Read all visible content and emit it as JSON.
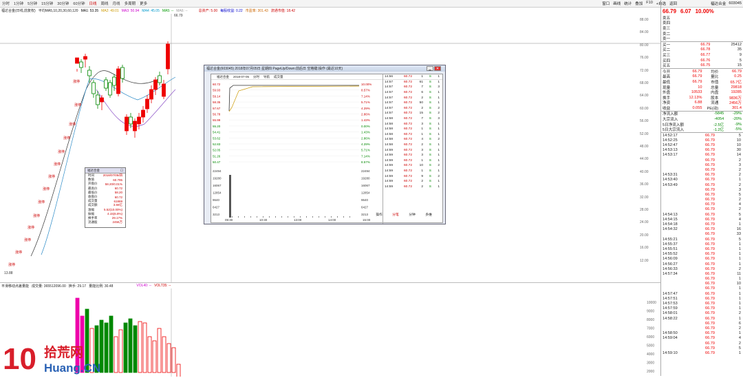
{
  "topbar": {
    "timeframes": [
      "分时",
      "1分钟",
      "5分钟",
      "15分钟",
      "30分钟",
      "60分钟",
      "日线",
      "周线",
      "月线",
      "多周期",
      "更多"
    ],
    "active": 6,
    "right": [
      "窗口",
      "画线",
      "统计",
      "叠加",
      "F10",
      "+自选",
      "返回"
    ]
  },
  "maline": {
    "stock": "福达合金(日线,前复权)",
    "ma": "平均MA5,10,20,30,60,120",
    "ma1": "MA1: 53.35",
    "ma2": "MA2: 49.01",
    "ma3": "MA3: 50.94",
    "ma4": "MA4: 45.05",
    "ma5": "MA5: --",
    "ma6": "MA6: --",
    "extra1": "总资产: 5.00",
    "extra2": "每股收益: 0.22",
    "extra3": "市盈率: 301.43",
    "extra4": "流通市值: 18.42"
  },
  "price_axis": [
    "88.00",
    "84.00",
    "80.00",
    "76.00",
    "72.00",
    "68.00",
    "64.00",
    "60.00",
    "56.00",
    "52.00",
    "48.00",
    "44.00",
    "40.00",
    "36.00",
    "32.00",
    "28.00",
    "24.00",
    "20.00",
    "16.00",
    "12.00"
  ],
  "cur_tag": "66.71",
  "high_label": "66.79",
  "low_label": "13.88",
  "stop_label": "涨停",
  "infobox": {
    "title": "福达合金",
    "rows": [
      [
        "时间",
        "2018/07/05/四"
      ],
      [
        "数值",
        "60.795"
      ],
      [
        "开盘价",
        "58.20/0.01%"
      ],
      [
        "最高价",
        "60.72"
      ],
      [
        "最低价",
        "58.20"
      ],
      [
        "收盘价",
        "60.72"
      ],
      [
        "成交量",
        "61869"
      ],
      [
        "成交额",
        "3.66亿"
      ],
      [
        "涨幅",
        "5.52(10.00%)"
      ],
      [
        "振幅",
        "4.15(6.8%)"
      ],
      [
        "换手率",
        "29.17%"
      ],
      [
        "流通股",
        "2456万"
      ]
    ]
  },
  "popup": {
    "title": "福达合金(603045) 2018年07月05日 星期四 PageUp/Down:前后日 空格键:操作 (最近10天)",
    "hd": [
      "福达合金",
      "2018-07-05",
      "分时",
      "导航",
      "成交量"
    ],
    "left_axis": [
      "60.72",
      "59.93",
      "59.14",
      "58.35",
      "57.67",
      "56.78",
      "55.99",
      "55.20",
      "54.41",
      "53.62",
      "52.83",
      "52.05",
      "51.26",
      "50.47"
    ],
    "right_axis": [
      "10.00%",
      "8.57%",
      "7.14%",
      "5.71%",
      "4.29%",
      "2.86%",
      "1.43%",
      "0.00%",
      "1.43%",
      "2.86%",
      "4.29%",
      "5.71%",
      "7.14%",
      "8.57%"
    ],
    "vol_axis": [
      "22494",
      "19280",
      "16067",
      "12854",
      "9640",
      "6427",
      "3213"
    ],
    "times": [
      "09:30",
      "10:30",
      "13:00",
      "14:00",
      "15:00"
    ],
    "tabs": [
      "操作",
      "分笔",
      "分钟",
      "多维"
    ],
    "ticks": [
      [
        "14:56",
        "60.72",
        "1",
        "S",
        "1"
      ],
      [
        "14:57",
        "60.72",
        "61",
        "S",
        "1"
      ],
      [
        "14:57",
        "60.72",
        "7",
        "S",
        "3"
      ],
      [
        "14:57",
        "60.72",
        "6",
        "S",
        "1"
      ],
      [
        "14:57",
        "60.72",
        "2",
        "S",
        "1"
      ],
      [
        "14:57",
        "60.72",
        "50",
        "S",
        "1"
      ],
      [
        "14:57",
        "60.72",
        "2",
        "S",
        "2"
      ],
      [
        "14:57",
        "60.72",
        "15",
        "S",
        "2"
      ],
      [
        "14:58",
        "60.72",
        "7",
        "S",
        "3"
      ],
      [
        "14:58",
        "60.72",
        "3",
        "S",
        "1"
      ],
      [
        "14:58",
        "60.72",
        "1",
        "S",
        "1"
      ],
      [
        "14:58",
        "60.72",
        "1",
        "S",
        "1"
      ],
      [
        "14:58",
        "60.72",
        "4",
        "S",
        "2"
      ],
      [
        "14:58",
        "60.72",
        "2",
        "S",
        "1"
      ],
      [
        "14:59",
        "60.72",
        "3",
        "S",
        "1"
      ],
      [
        "14:59",
        "60.72",
        "3",
        "S",
        "1"
      ],
      [
        "14:59",
        "60.72",
        "1",
        "S",
        "1"
      ],
      [
        "14:59",
        "60.72",
        "10",
        "S",
        "2"
      ],
      [
        "14:59",
        "60.72",
        "1",
        "S",
        "1"
      ],
      [
        "14:59",
        "60.72",
        "9",
        "S",
        "2"
      ],
      [
        "14:59",
        "60.72",
        "2",
        "S",
        "1"
      ],
      [
        "14:59",
        "60.72",
        "2",
        "S",
        "1"
      ]
    ]
  },
  "right": {
    "name": "福达合金",
    "code": "603045",
    "price": "66.79",
    "change": "6.07",
    "pct": "10.00%",
    "asks": [
      [
        "卖五",
        "",
        ""
      ],
      [
        "卖四",
        "",
        ""
      ],
      [
        "卖三",
        "",
        ""
      ],
      [
        "卖二",
        "",
        ""
      ],
      [
        "卖一",
        "",
        ""
      ]
    ],
    "bids": [
      [
        "买一",
        "66.79",
        "25412"
      ],
      [
        "买二",
        "66.78",
        "35"
      ],
      [
        "买三",
        "66.77",
        "9"
      ],
      [
        "买四",
        "66.76",
        "5"
      ],
      [
        "买五",
        "66.75",
        "15"
      ]
    ],
    "stats": [
      [
        "今开",
        "66.79",
        "均价",
        "66.79"
      ],
      [
        "最高",
        "66.79",
        "量比",
        "0.25"
      ],
      [
        "最低",
        "66.79",
        "市值",
        "65.7亿"
      ],
      [
        "现量",
        "10",
        "总量",
        "29818"
      ],
      [
        "外盘",
        "10533",
        "内盘",
        "19285"
      ],
      [
        "换手",
        "12.13%",
        "股本",
        "9836万"
      ],
      [
        "净资",
        "6.88",
        "流通",
        "2456万"
      ],
      [
        "收益",
        "0.055",
        "PE(动)",
        "301.4"
      ]
    ],
    "flows": [
      [
        "净流入额",
        "-5845",
        "-29%"
      ],
      [
        "大宗流入",
        "-4054",
        "-20%"
      ],
      [
        "5日净流入额",
        "-2.5亿",
        "-9%"
      ],
      [
        "5日大宗流入",
        "-1.2亿",
        "-5%"
      ]
    ],
    "trades": [
      [
        "14:52:17",
        "66.79",
        "5"
      ],
      [
        "14:52:25",
        "66.79",
        "10"
      ],
      [
        "14:52:47",
        "66.79",
        "10"
      ],
      [
        "14:53:13",
        "66.79",
        "30"
      ],
      [
        "14:53:17",
        "66.79",
        "14"
      ],
      [
        "",
        "66.79",
        "2"
      ],
      [
        "",
        "66.79",
        "3"
      ],
      [
        "",
        "66.79",
        "2"
      ],
      [
        "14:53:31",
        "66.79",
        "2"
      ],
      [
        "14:53:40",
        "66.79",
        "1"
      ],
      [
        "14:53:49",
        "66.79",
        "2"
      ],
      [
        "",
        "66.79",
        "3"
      ],
      [
        "",
        "66.79",
        "5"
      ],
      [
        "",
        "66.79",
        "2"
      ],
      [
        "",
        "66.79",
        "4"
      ],
      [
        "",
        "66.79",
        "2"
      ],
      [
        "14:54:13",
        "66.79",
        "5"
      ],
      [
        "14:54:15",
        "66.79",
        "4"
      ],
      [
        "14:54:18",
        "66.79",
        "1"
      ],
      [
        "14:54:32",
        "66.79",
        "16"
      ],
      [
        "",
        "66.79",
        "33"
      ],
      [
        "14:55:21",
        "66.79",
        "5"
      ],
      [
        "14:55:37",
        "66.79",
        "1"
      ],
      [
        "14:55:51",
        "66.79",
        "1"
      ],
      [
        "14:55:52",
        "66.79",
        "1"
      ],
      [
        "14:56:09",
        "66.79",
        "1"
      ],
      [
        "14:56:27",
        "66.79",
        "1"
      ],
      [
        "14:56:33",
        "66.79",
        "2"
      ],
      [
        "14:57:34",
        "66.79",
        "11"
      ],
      [
        "",
        "66.79",
        "1"
      ],
      [
        "",
        "66.79",
        "10"
      ],
      [
        "",
        "66.79",
        "1"
      ],
      [
        "14:57:47",
        "66.79",
        "1"
      ],
      [
        "14:57:51",
        "66.79",
        "1"
      ],
      [
        "14:57:53",
        "66.79",
        "1"
      ],
      [
        "14:57:59",
        "66.79",
        "1"
      ],
      [
        "14:58:01",
        "66.79",
        "2"
      ],
      [
        "14:58:22",
        "66.79",
        "1"
      ],
      [
        "",
        "66.79",
        "6"
      ],
      [
        "",
        "66.79",
        "2"
      ],
      [
        "14:58:50",
        "66.79",
        "1"
      ],
      [
        "14:59:04",
        "66.79",
        "4"
      ],
      [
        "",
        "66.79",
        "2"
      ],
      [
        "",
        "66.79",
        "5"
      ],
      [
        "14:59:10",
        "66.79",
        "1"
      ]
    ]
  },
  "vol": {
    "label": "平滑移动点差量能",
    "v1": "成交量: 365512096.00",
    "v2": "换手: 29.17",
    "v3": "量能比例: 30.48",
    "vol": "VOL40: --",
    "volt": "VOLT35: --",
    "axis": [
      "10000",
      "9000",
      "8000",
      "7000",
      "6000",
      "5000",
      "4000",
      "3000",
      "2000"
    ]
  },
  "logo": {
    "main": "拾荒网",
    "sub": "Huang.CN",
    "ten": "10"
  }
}
